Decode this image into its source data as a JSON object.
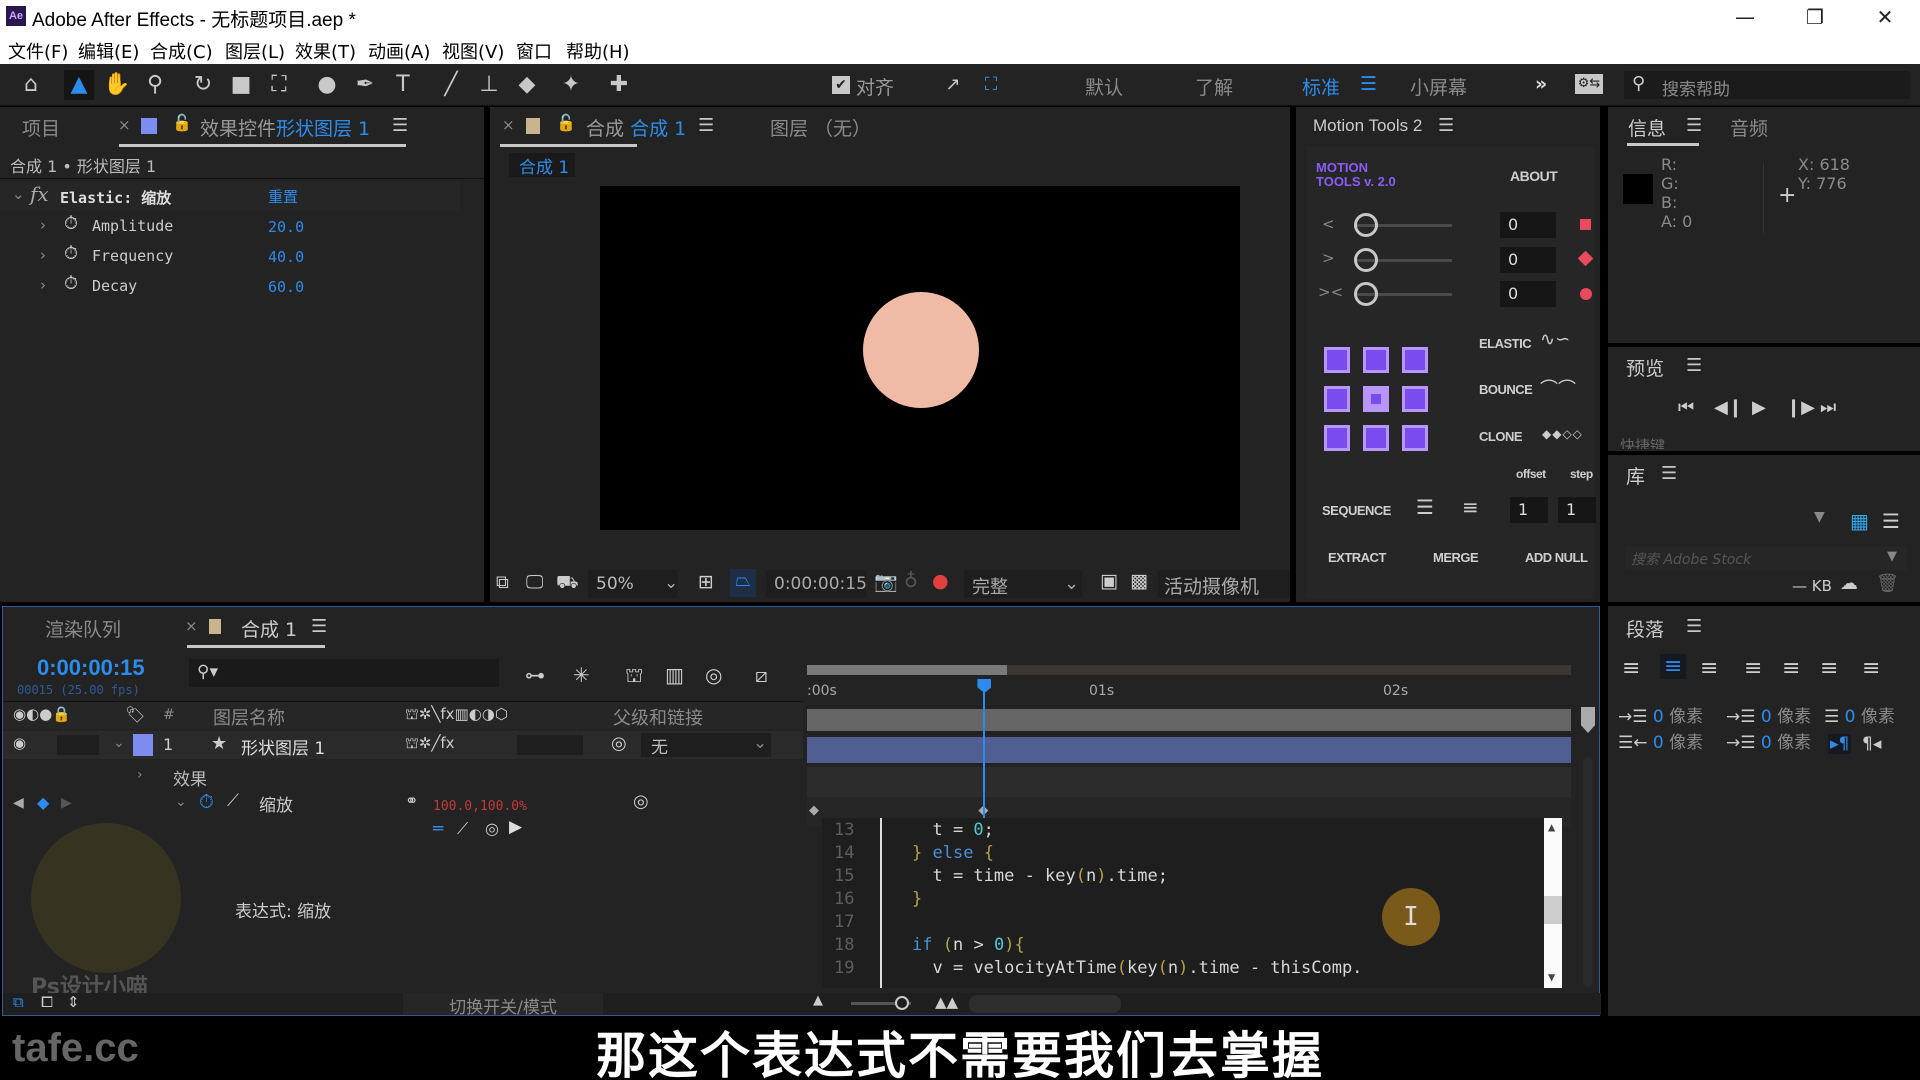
{
  "window": {
    "app_icon": "Ae",
    "title": "Adobe After Effects - 无标题项目.aep *",
    "controls": {
      "minimize": "—",
      "restore": "❐",
      "close": "✕"
    }
  },
  "menu": [
    "文件(F)",
    "编辑(E)",
    "合成(C)",
    "图层(L)",
    "效果(T)",
    "动画(A)",
    "视图(V)",
    "窗口",
    "帮助(H)"
  ],
  "toolbar": {
    "tools": [
      "home",
      "selection",
      "hand",
      "zoom",
      "rotate",
      "camera",
      "pan-behind",
      "ellipse",
      "pen",
      "type",
      "brush",
      "clone-stamp",
      "eraser",
      "roto-brush",
      "puppet-pin"
    ],
    "snap_label": "对齐",
    "snap_checked": true,
    "workspaces": [
      "默认",
      "了解",
      "标准",
      "小屏幕"
    ],
    "active_workspace": "标准",
    "more": "»",
    "search_placeholder": "搜索帮助"
  },
  "project_panel": {
    "tab_project": "项目",
    "tab_effects": "效果控件",
    "tab_effects_target": "形状图层 1",
    "breadcrumb": "合成 1 • 形状图层 1",
    "effect": {
      "name": "Elastic: 缩放",
      "reset": "重置",
      "params": [
        {
          "name": "Amplitude",
          "value": "20.0"
        },
        {
          "name": "Frequency",
          "value": "40.0"
        },
        {
          "name": "Decay",
          "value": "60.0"
        }
      ]
    }
  },
  "comp_panel": {
    "tab_prefix": "合成",
    "tab_name": "合成 1",
    "tab_layer": "图层 （无）",
    "flow_tab": "合成 1",
    "circle_color": "#f0bba6",
    "zoom": "50%",
    "timecode": "0:00:00:15",
    "resolution": "完整",
    "camera": "活动摄像机"
  },
  "motion_tools": {
    "title": "Motion Tools 2",
    "logo_line1": "MOTION",
    "logo_line2": "TOOLS v. 2.0",
    "about": "ABOUT",
    "sliders": [
      {
        "icon": "<",
        "value": "0"
      },
      {
        "icon": ">",
        "value": "0"
      },
      {
        "icon": "><",
        "value": "0"
      }
    ],
    "elastic": "ELASTIC",
    "bounce": "BOUNCE",
    "clone": "CLONE",
    "offset_label": "offset",
    "step_label": "step",
    "sequence": "SEQUENCE",
    "offset_value": "1",
    "step_value": "1",
    "extract": "EXTRACT",
    "merge": "MERGE",
    "add_null": "ADD NULL",
    "accent": "#7a4cf0"
  },
  "info_panel": {
    "tab_info": "信息",
    "tab_audio": "音频",
    "r": "R:",
    "g": "G:",
    "b": "B:",
    "a": "A:  0",
    "x": "X: 618",
    "y": "Y: 776"
  },
  "preview_panel": {
    "title": "预览",
    "shortcut_label": "快捷键"
  },
  "library_panel": {
    "title": "库",
    "search_placeholder": "搜索 Adobe Stock",
    "size": "— KB"
  },
  "paragraph_panel": {
    "title": "段落",
    "unit": "像素",
    "indent_values": [
      "0",
      "0",
      "0",
      "0",
      "0"
    ]
  },
  "timeline": {
    "tab_render": "渲染队列",
    "tab_comp": "合成 1",
    "timecode": "0:00:00:15",
    "frame_info": "00015 (25.00 fps)",
    "search_placeholder": "",
    "col_layer_name": "图层名称",
    "col_parent": "父级和链接",
    "col_number": "#",
    "layer": {
      "index": "1",
      "name": "形状图层 1",
      "parent": "无"
    },
    "effects_label": "效果",
    "scale_label": "缩放",
    "scale_value": "100.0,100.0%",
    "expression_label": "表达式: 缩放",
    "ruler": [
      ":00s",
      "01s",
      "02s"
    ],
    "toggle_label": "切换开关/模式",
    "playhead_seconds": 0.6,
    "work_area_end_seconds": 0.68
  },
  "code": [
    {
      "n": "13",
      "text": "  t = 0;"
    },
    {
      "n": "14",
      "text": "} else {"
    },
    {
      "n": "15",
      "text": "  t = time - key(n).time;"
    },
    {
      "n": "16",
      "text": "}"
    },
    {
      "n": "17",
      "text": ""
    },
    {
      "n": "18",
      "text": "if (n > 0){"
    },
    {
      "n": "19",
      "text": "  v = velocityAtTime(key(n).time - thisComp."
    }
  ],
  "watermark": {
    "site": "tafe.cc",
    "author": "Ps设计小喵"
  },
  "subtitle": "那这个表达式不需要我们去掌握"
}
